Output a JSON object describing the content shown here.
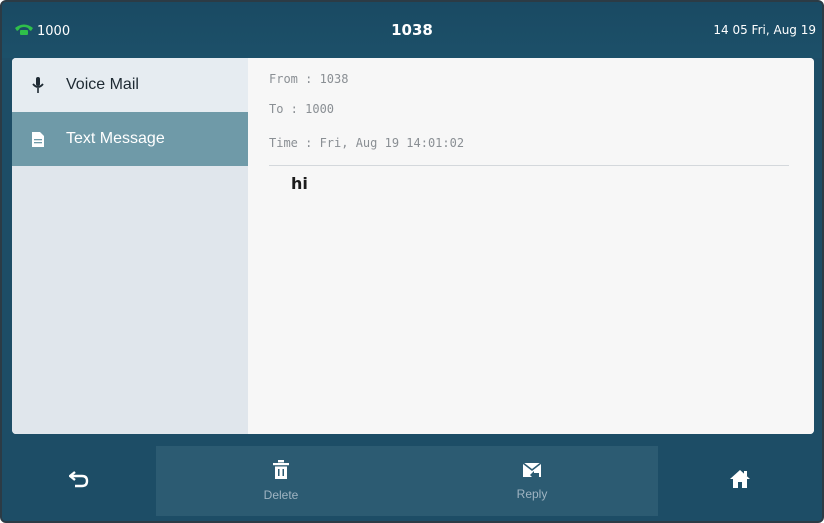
{
  "status_bar": {
    "line_number": "1000",
    "title": "1038",
    "datetime": "14 05 Fri, Aug 19"
  },
  "sidebar": {
    "items": [
      {
        "label": "Voice Mail",
        "icon": "microphone-icon",
        "selected": false
      },
      {
        "label": "Text Message",
        "icon": "document-icon",
        "selected": true
      }
    ]
  },
  "message": {
    "from": "From : 1038",
    "to": "To : 1000",
    "time": "Time : Fri, Aug 19 14:01:02",
    "body": "hi"
  },
  "softkeys": {
    "back_icon": "back-arrow-icon",
    "delete_label": "Delete",
    "delete_icon": "trash-icon",
    "reply_label": "Reply",
    "reply_icon": "envelope-reply-icon",
    "home_icon": "home-icon"
  },
  "colors": {
    "status_bg": "#1c4d66",
    "phone_icon": "#2fbf4a",
    "selected_item_bg": "#6f9aa8",
    "softkey_bg": "#2c5b72"
  }
}
